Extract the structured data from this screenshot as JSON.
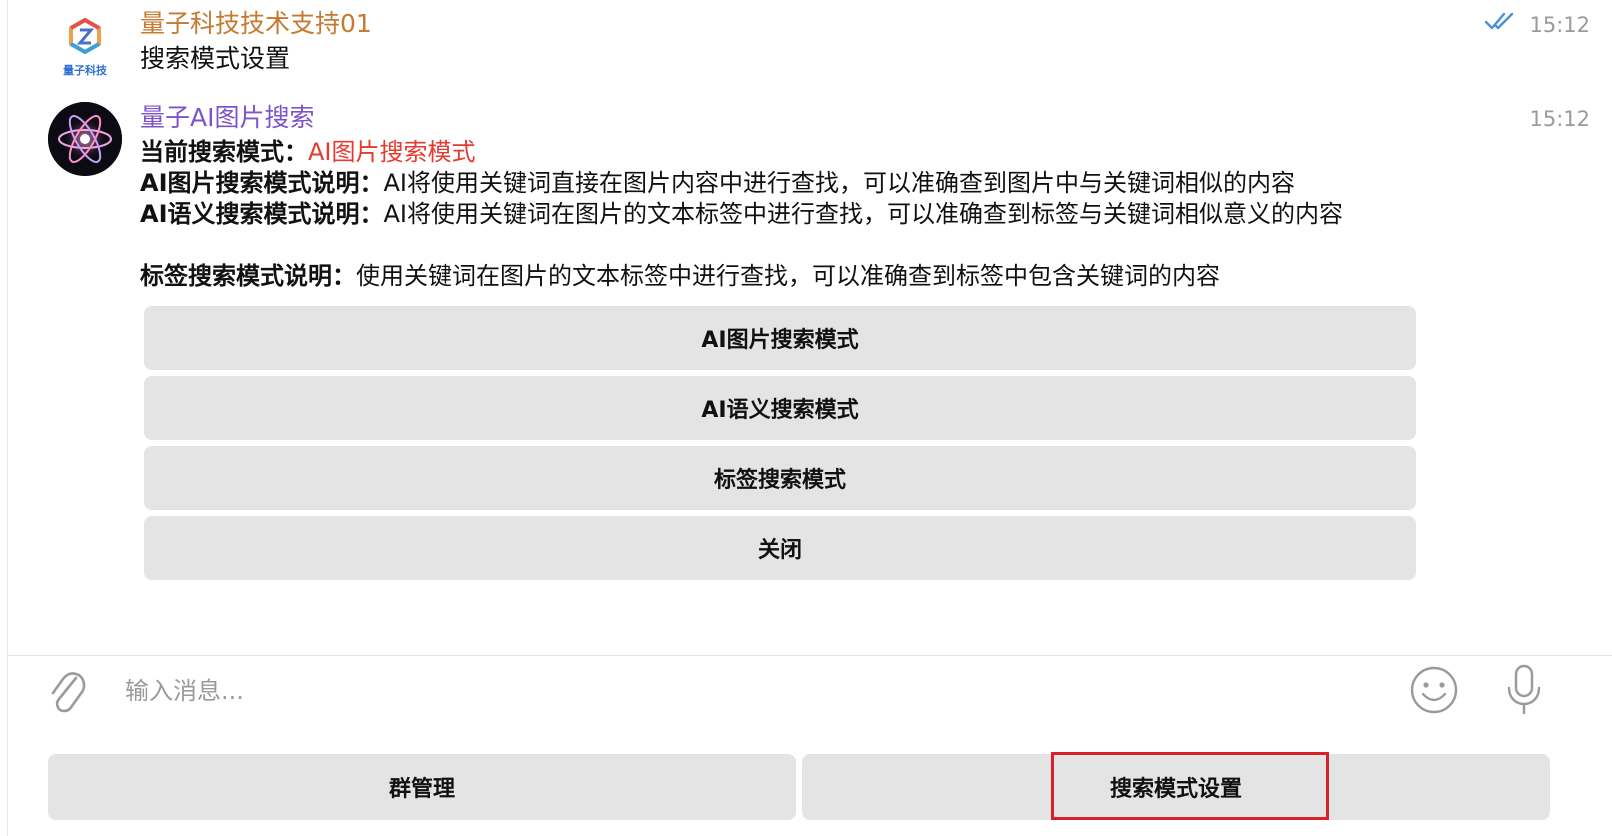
{
  "messages": [
    {
      "sender": "量子科技技术支持01",
      "text": "搜索模式设置",
      "time": "15:12",
      "avatar_text": "量子科技",
      "status": "read-double-check"
    },
    {
      "sender": "量子AI图片搜索",
      "time": "15:12",
      "lines": {
        "current_label": "当前搜索模式：",
        "current_value": "AI图片搜索模式",
        "ai_image_label": "AI图片搜索模式说明：",
        "ai_image_desc": "AI将使用关键词直接在图片内容中进行查找，可以准确查到图片中与关键词相似的内容",
        "ai_semantic_label": "AI语义搜索模式说明：",
        "ai_semantic_desc": "AI将使用关键词在图片的文本标签中进行查找，可以准确查到标签与关键词相似意义的内容",
        "tag_label": "标签搜索模式说明：",
        "tag_desc": "使用关键词在图片的文本标签中进行查找，可以准确查到标签中包含关键词的内容"
      },
      "inline_buttons": [
        "AI图片搜索模式",
        "AI语义搜索模式",
        "标签搜索模式",
        "关闭"
      ]
    }
  ],
  "composer": {
    "placeholder": "输入消息...",
    "icons": [
      "paperclip-icon",
      "emoji-icon",
      "microphone-icon"
    ]
  },
  "reply_keyboard": {
    "buttons": [
      "群管理",
      "搜索模式设置"
    ],
    "highlighted": "搜索模式设置"
  },
  "colors": {
    "sender1": "#c57a2f",
    "sender2": "#7d53c9",
    "current_mode": "#e43a2f",
    "button_bg": "#e4e4e4",
    "highlight_border": "#d7212b",
    "read_check": "#4a90d9"
  }
}
